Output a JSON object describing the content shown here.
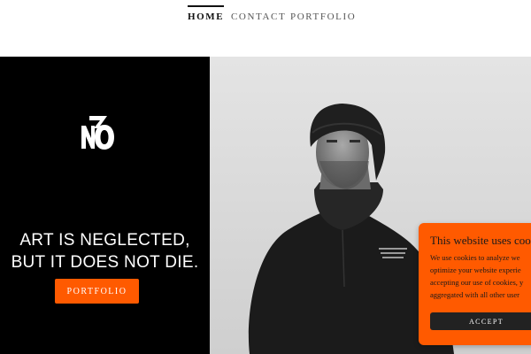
{
  "nav": {
    "items": [
      {
        "label": "HOME",
        "active": true
      },
      {
        "label": "CONTACT",
        "active": false
      },
      {
        "label": "PORTFOLIO",
        "active": false
      }
    ]
  },
  "hero": {
    "headline_line1": "ART IS NEGLECTED,",
    "headline_line2": "BUT IT DOES NOT DIE.",
    "cta_label": "PORTFOLIO",
    "image": "black-and-white-portrait-man-beanie",
    "logo": "70-logo"
  },
  "cookie_banner": {
    "title": "This website uses cook",
    "body_lines": [
      "We use cookies to analyze we",
      "optimize your website experie",
      "accepting our use of cookies, y",
      "aggregated with all other user"
    ],
    "accept_label": "ACCEPT"
  },
  "colors": {
    "accent": "#ff5a00",
    "hero_left_bg": "#000000",
    "accept_button_bg": "#222222"
  }
}
